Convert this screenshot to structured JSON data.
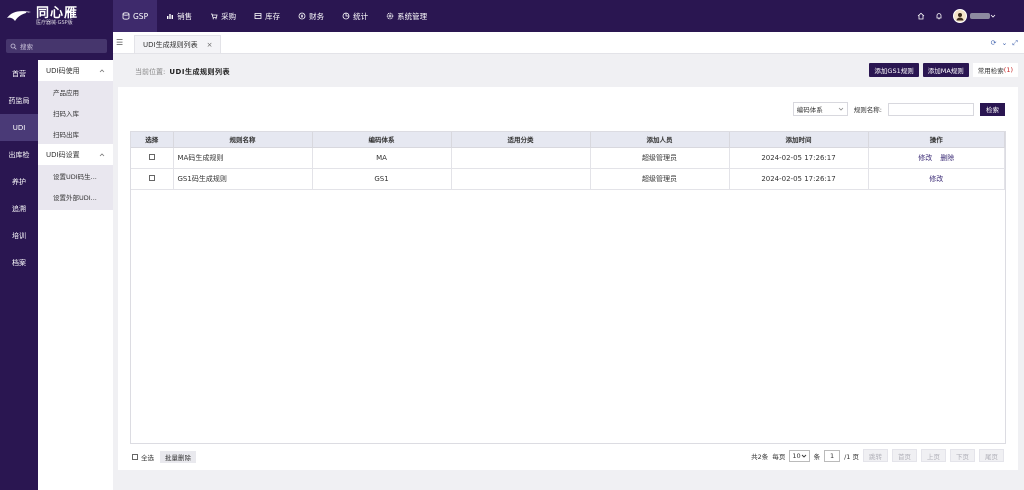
{
  "logo": {
    "title": "同心雁",
    "subtitle": "医疗器械·GSP版"
  },
  "top_nav": [
    {
      "label": "GSP",
      "icon": "database-icon",
      "active": true
    },
    {
      "label": "销售",
      "icon": "bar-chart-icon"
    },
    {
      "label": "采购",
      "icon": "cart-icon"
    },
    {
      "label": "库存",
      "icon": "inventory-icon"
    },
    {
      "label": "财务",
      "icon": "finance-icon"
    },
    {
      "label": "统计",
      "icon": "stats-icon"
    },
    {
      "label": "系统管理",
      "icon": "gear-icon"
    }
  ],
  "search": {
    "placeholder": "搜索"
  },
  "sidebar": [
    "首营",
    "药监局",
    "UDI",
    "出库检",
    "养护",
    "追溯",
    "培训",
    "档案"
  ],
  "submenu": {
    "group1": "UDI码使用",
    "group1_items": [
      "产品应用",
      "扫码入库",
      "扫码出库"
    ],
    "group2": "UDI码设置",
    "group2_items": [
      "设置UDI码生...",
      "设置外部UDI..."
    ]
  },
  "tab": {
    "label": "UDI生成规则列表",
    "close": "×"
  },
  "breadcrumb": {
    "prefix": "当前位置:",
    "current": "UDI生成规则列表"
  },
  "actions": {
    "add_gs1": "添加GS1规则",
    "add_ma": "添加MA规则",
    "common_search": "常用检索",
    "common_count": "(1)"
  },
  "filters": {
    "coding_system": "编码体系",
    "rule_name_label": "规则名称:",
    "search_btn": "检索"
  },
  "table": {
    "headers": [
      "选择",
      "规则名称",
      "编码体系",
      "适用分类",
      "添加人员",
      "添加时间",
      "操作"
    ],
    "rows": [
      {
        "name": "MA码生成规则",
        "system": "MA",
        "category": "",
        "user": "超级管理员",
        "time": "2024-02-05 17:26:17",
        "ops": [
          "修改",
          "删除"
        ]
      },
      {
        "name": "GS1码生成规则",
        "system": "GS1",
        "category": "",
        "user": "超级管理员",
        "time": "2024-02-05 17:26:17",
        "ops": [
          "修改"
        ]
      }
    ]
  },
  "footer": {
    "select_all": "全选",
    "batch_delete": "批量删除",
    "total": "共2条",
    "per_page": "每页",
    "page_size": "10",
    "unit": "条",
    "current_page": "1",
    "total_pages": "/1 页",
    "jump": "跳转",
    "first": "首页",
    "prev": "上页",
    "next": "下页",
    "last": "尾页"
  },
  "colors": {
    "brand": "#2a1651",
    "header_bg": "#e6e8f1"
  }
}
